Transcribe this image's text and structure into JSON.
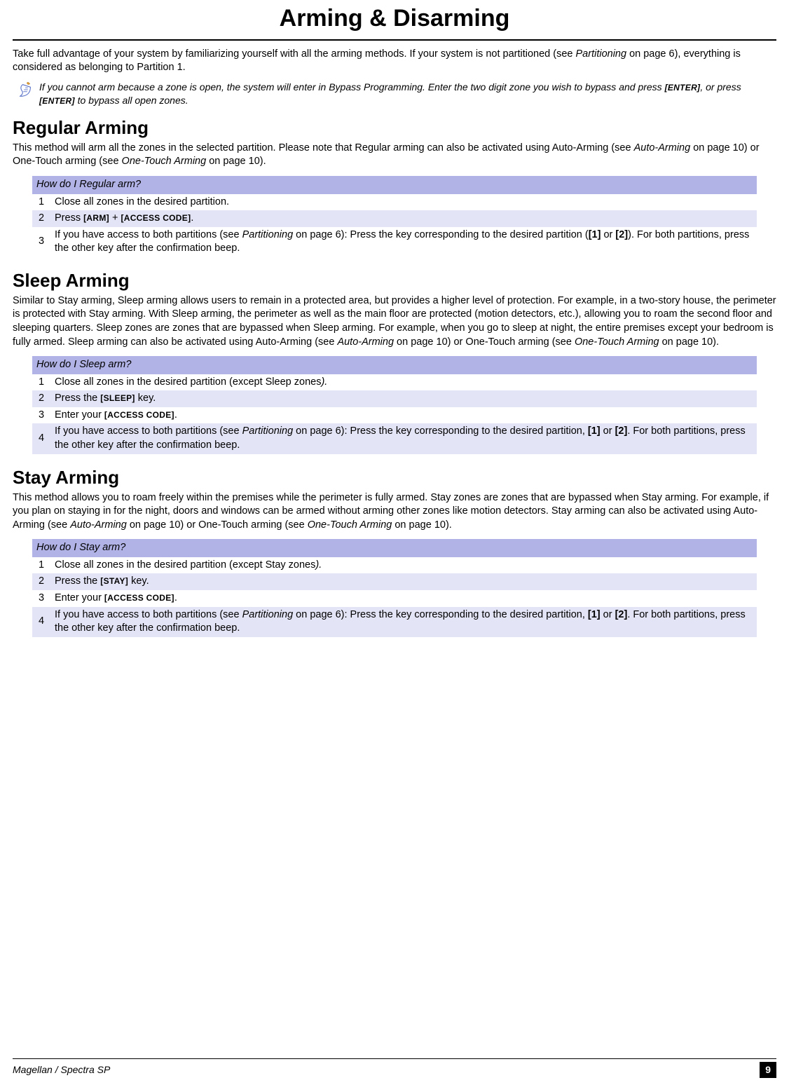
{
  "page": {
    "title": "Arming & Disarming",
    "footer_left": "Magellan / Spectra SP",
    "footer_page": "9"
  },
  "intro": {
    "p1a": "Take full advantage of your system by familiarizing yourself with all the arming methods. If your system is not partitioned (see ",
    "p1_ref": "Partitioning",
    "p1b": " on page 6), everything is considered as belonging to Partition 1."
  },
  "note": {
    "t1": "If you cannot arm because a zone is open, the system will enter in Bypass Programming. Enter the two digit zone you wish to bypass and press ",
    "k1": "[ENTER]",
    "t2": ", or press ",
    "k2": "[ENTER]",
    "t3": " to bypass all open zones."
  },
  "regular": {
    "heading": "Regular Arming",
    "p1a": "This method will arm all the zones in the selected partition. Please note that Regular arming can also be activated using Auto-Arming (see ",
    "ref1": "Auto-Arming",
    "p1b": " on page 10) or One-Touch arming (see ",
    "ref2": "One-Touch Arming",
    "p1c": " on page 10).",
    "table_header": "How do I Regular arm?",
    "steps": {
      "s1": "Close all zones in the desired partition.",
      "s2_a": "Press ",
      "s2_k1": "[ARM]",
      "s2_b": " + ",
      "s2_k2": "[ACCESS CODE]",
      "s2_c": ".",
      "s3_a": "If you have access to both partitions (see ",
      "s3_ref": "Partitioning",
      "s3_b": " on page 6): Press the key corresponding to the desired partition (",
      "s3_k1": "[1]",
      "s3_c": " or ",
      "s3_k2": "[2]",
      "s3_d": "). For both partitions, press the other key after the confirmation beep."
    }
  },
  "sleep": {
    "heading": "Sleep Arming",
    "p1a": "Similar to Stay arming, Sleep arming allows users to remain in a protected area, but provides a higher level of protection. For example, in a two-story house, the perimeter is protected with Stay arming. With Sleep arming, the perimeter as well as the main floor are protected (motion detectors, etc.), allowing you to roam the second floor and sleeping quarters. Sleep zones are zones that are bypassed when Sleep arming. For example, when you go to sleep at night, the entire premises except your bedroom is fully armed. Sleep arming can also be activated using Auto-Arming (see ",
    "ref1": "Auto-Arming",
    "p1b": " on page 10) or One-Touch arming (see ",
    "ref2": "One-Touch Arming",
    "p1c": " on page 10).",
    "table_header": "How do I Sleep arm?",
    "steps": {
      "s1_a": "Close all zones in the desired partition (except Sleep zones",
      "s1_b": ").",
      "s2_a": "Press the ",
      "s2_k1": "[SLEEP]",
      "s2_b": " key.",
      "s3_a": "Enter your ",
      "s3_k1": "[ACCESS CODE]",
      "s3_b": ".",
      "s4_a": "If you have access to both partitions (see ",
      "s4_ref": "Partitioning",
      "s4_b": " on page 6): Press the key corresponding to the desired partition, ",
      "s4_k1": "[1]",
      "s4_c": " or ",
      "s4_k2": "[2]",
      "s4_d": ". For both partitions, press the other key after the confirmation beep."
    }
  },
  "stay": {
    "heading": "Stay Arming",
    "p1a": "This method allows you to roam freely within the premises while the perimeter is fully armed. Stay zones are zones that are bypassed when Stay arming. For example, if you plan on staying in for the night, doors and windows can be armed without arming other zones like motion detectors. Stay arming can also be activated using Auto-Arming (see ",
    "ref1": "Auto-Arming",
    "p1b": " on page 10) or One-Touch arming (see ",
    "ref2": "One-Touch Arming",
    "p1c": " on page 10).",
    "table_header": "How do I Stay arm?",
    "steps": {
      "s1_a": "Close all zones in the desired partition (except Stay zones",
      "s1_b": ").",
      "s2_a": "Press the ",
      "s2_k1": "[STAY]",
      "s2_b": " key.",
      "s3_a": "Enter your ",
      "s3_k1": "[ACCESS CODE]",
      "s3_b": ".",
      "s4_a": "If you have access to both partitions (see ",
      "s4_ref": "Partitioning",
      "s4_b": " on page 6): Press the key corresponding to the desired partition, ",
      "s4_k1": "[1]",
      "s4_c": " or ",
      "s4_k2": "[2]",
      "s4_d": ". For both partitions, press the other key after the confirmation beep."
    }
  }
}
